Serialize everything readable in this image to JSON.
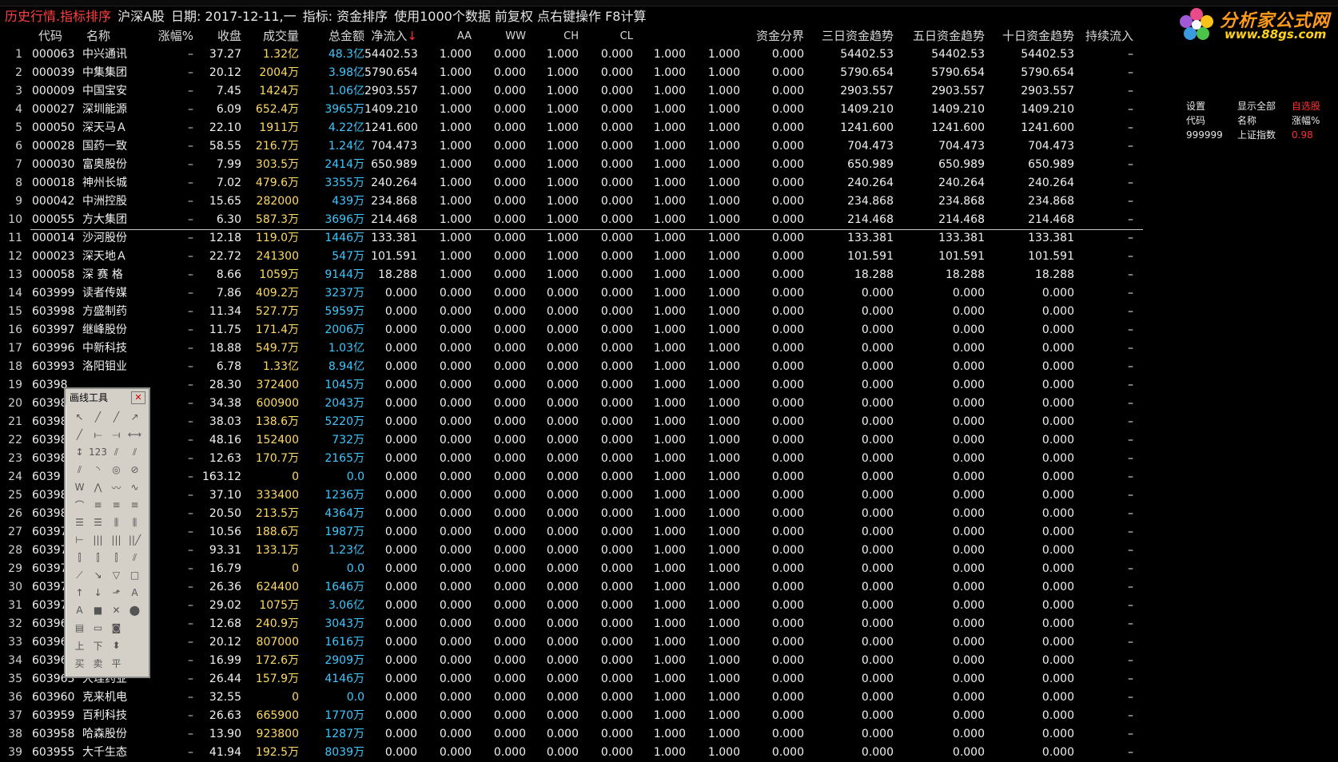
{
  "title_bar": {
    "mode": "历史行情.指标排序",
    "market": "沪深A股",
    "date": "日期: 2017-12-11,一",
    "indicator": "指标: 资金排序",
    "options": "使用1000个数据 前复权 点右键操作 F8计算"
  },
  "logo": {
    "brand": "分析家公式网",
    "url": "www.88gs.com"
  },
  "columns": {
    "code": "代码",
    "name": "名称",
    "change": "涨幅%",
    "close": "收盘",
    "volume": "成交量",
    "amount": "总金额",
    "net_inflow": "净流入",
    "sort_arrow": "↓",
    "aa": "AA",
    "ww": "WW",
    "ch": "CH",
    "cl": "CL",
    "fund_boundary": "资金分界",
    "trend3": "三日资金趋势",
    "trend5": "五日资金趋势",
    "trend10": "十日资金趋势",
    "continuous_inflow": "持续流入"
  },
  "rows": [
    {
      "i": "1",
      "code": "000063",
      "name": "中兴通讯",
      "chg": "–",
      "close": "37.27",
      "vol": "1.32亿",
      "amt": "48.3亿",
      "net": "54402.53",
      "aa": "1.000",
      "ww": "0.000",
      "ch": "1.000",
      "cl": "0.000",
      "x1": "1.000",
      "x2": "1.000",
      "fund": "0.000",
      "t3": "54402.53",
      "t5": "54402.53",
      "t10": "54402.53",
      "cont": "–"
    },
    {
      "i": "2",
      "code": "000039",
      "name": "中集集团",
      "chg": "–",
      "close": "20.12",
      "vol": "2004万",
      "amt": "3.98亿",
      "net": "5790.654",
      "aa": "1.000",
      "ww": "0.000",
      "ch": "1.000",
      "cl": "0.000",
      "x1": "1.000",
      "x2": "1.000",
      "fund": "0.000",
      "t3": "5790.654",
      "t5": "5790.654",
      "t10": "5790.654",
      "cont": "–"
    },
    {
      "i": "3",
      "code": "000009",
      "name": "中国宝安",
      "chg": "–",
      "close": "7.45",
      "vol": "1424万",
      "amt": "1.06亿",
      "net": "2903.557",
      "aa": "1.000",
      "ww": "0.000",
      "ch": "1.000",
      "cl": "0.000",
      "x1": "1.000",
      "x2": "1.000",
      "fund": "0.000",
      "t3": "2903.557",
      "t5": "2903.557",
      "t10": "2903.557",
      "cont": "–"
    },
    {
      "i": "4",
      "code": "000027",
      "name": "深圳能源",
      "chg": "–",
      "close": "6.09",
      "vol": "652.4万",
      "amt": "3965万",
      "net": "1409.210",
      "aa": "1.000",
      "ww": "0.000",
      "ch": "1.000",
      "cl": "0.000",
      "x1": "1.000",
      "x2": "1.000",
      "fund": "0.000",
      "t3": "1409.210",
      "t5": "1409.210",
      "t10": "1409.210",
      "cont": "–"
    },
    {
      "i": "5",
      "code": "000050",
      "name": "深天马Ａ",
      "chg": "–",
      "close": "22.10",
      "vol": "1911万",
      "amt": "4.22亿",
      "net": "1241.600",
      "aa": "1.000",
      "ww": "0.000",
      "ch": "1.000",
      "cl": "0.000",
      "x1": "1.000",
      "x2": "1.000",
      "fund": "0.000",
      "t3": "1241.600",
      "t5": "1241.600",
      "t10": "1241.600",
      "cont": "–"
    },
    {
      "i": "6",
      "code": "000028",
      "name": "国药一致",
      "chg": "–",
      "close": "58.55",
      "vol": "216.7万",
      "amt": "1.24亿",
      "net": "704.473",
      "aa": "1.000",
      "ww": "0.000",
      "ch": "1.000",
      "cl": "0.000",
      "x1": "1.000",
      "x2": "1.000",
      "fund": "0.000",
      "t3": "704.473",
      "t5": "704.473",
      "t10": "704.473",
      "cont": "–"
    },
    {
      "i": "7",
      "code": "000030",
      "name": "富奥股份",
      "chg": "–",
      "close": "7.99",
      "vol": "303.5万",
      "amt": "2414万",
      "net": "650.989",
      "aa": "1.000",
      "ww": "0.000",
      "ch": "1.000",
      "cl": "0.000",
      "x1": "1.000",
      "x2": "1.000",
      "fund": "0.000",
      "t3": "650.989",
      "t5": "650.989",
      "t10": "650.989",
      "cont": "–"
    },
    {
      "i": "8",
      "code": "000018",
      "name": "神州长城",
      "chg": "–",
      "close": "7.02",
      "vol": "479.6万",
      "amt": "3355万",
      "net": "240.264",
      "aa": "1.000",
      "ww": "0.000",
      "ch": "1.000",
      "cl": "0.000",
      "x1": "1.000",
      "x2": "1.000",
      "fund": "0.000",
      "t3": "240.264",
      "t5": "240.264",
      "t10": "240.264",
      "cont": "–"
    },
    {
      "i": "9",
      "code": "000042",
      "name": "中洲控股",
      "chg": "–",
      "close": "15.65",
      "vol": "282000",
      "amt": "439万",
      "net": "234.868",
      "aa": "1.000",
      "ww": "0.000",
      "ch": "1.000",
      "cl": "0.000",
      "x1": "1.000",
      "x2": "1.000",
      "fund": "0.000",
      "t3": "234.868",
      "t5": "234.868",
      "t10": "234.868",
      "cont": "–"
    },
    {
      "i": "10",
      "code": "000055",
      "name": "方大集团",
      "chg": "–",
      "close": "6.30",
      "vol": "587.3万",
      "amt": "3696万",
      "net": "214.468",
      "aa": "1.000",
      "ww": "0.000",
      "ch": "1.000",
      "cl": "0.000",
      "x1": "1.000",
      "x2": "1.000",
      "fund": "0.000",
      "t3": "214.468",
      "t5": "214.468",
      "t10": "214.468",
      "cont": "–"
    },
    {
      "i": "11",
      "code": "000014",
      "name": "沙河股份",
      "chg": "–",
      "close": "12.18",
      "vol": "119.0万",
      "amt": "1446万",
      "net": "133.381",
      "aa": "1.000",
      "ww": "0.000",
      "ch": "1.000",
      "cl": "0.000",
      "x1": "1.000",
      "x2": "1.000",
      "fund": "0.000",
      "t3": "133.381",
      "t5": "133.381",
      "t10": "133.381",
      "cont": "–"
    },
    {
      "i": "12",
      "code": "000023",
      "name": "深天地Ａ",
      "chg": "–",
      "close": "22.72",
      "vol": "241300",
      "amt": "547万",
      "net": "101.591",
      "aa": "1.000",
      "ww": "0.000",
      "ch": "1.000",
      "cl": "0.000",
      "x1": "1.000",
      "x2": "1.000",
      "fund": "0.000",
      "t3": "101.591",
      "t5": "101.591",
      "t10": "101.591",
      "cont": "–"
    },
    {
      "i": "13",
      "code": "000058",
      "name": "深 赛 格",
      "chg": "–",
      "close": "8.66",
      "vol": "1059万",
      "amt": "9144万",
      "net": "18.288",
      "aa": "1.000",
      "ww": "0.000",
      "ch": "1.000",
      "cl": "0.000",
      "x1": "1.000",
      "x2": "1.000",
      "fund": "0.000",
      "t3": "18.288",
      "t5": "18.288",
      "t10": "18.288",
      "cont": "–"
    },
    {
      "i": "14",
      "code": "603999",
      "name": "读者传媒",
      "chg": "–",
      "close": "7.86",
      "vol": "409.2万",
      "amt": "3237万",
      "net": "0.000",
      "aa": "0.000",
      "ww": "0.000",
      "ch": "0.000",
      "cl": "0.000",
      "x1": "1.000",
      "x2": "1.000",
      "fund": "0.000",
      "t3": "0.000",
      "t5": "0.000",
      "t10": "0.000",
      "cont": "–"
    },
    {
      "i": "15",
      "code": "603998",
      "name": "方盛制药",
      "chg": "–",
      "close": "11.34",
      "vol": "527.7万",
      "amt": "5959万",
      "net": "0.000",
      "aa": "0.000",
      "ww": "0.000",
      "ch": "0.000",
      "cl": "0.000",
      "x1": "1.000",
      "x2": "1.000",
      "fund": "0.000",
      "t3": "0.000",
      "t5": "0.000",
      "t10": "0.000",
      "cont": "–"
    },
    {
      "i": "16",
      "code": "603997",
      "name": "继峰股份",
      "chg": "–",
      "close": "11.75",
      "vol": "171.4万",
      "amt": "2006万",
      "net": "0.000",
      "aa": "0.000",
      "ww": "0.000",
      "ch": "0.000",
      "cl": "0.000",
      "x1": "1.000",
      "x2": "1.000",
      "fund": "0.000",
      "t3": "0.000",
      "t5": "0.000",
      "t10": "0.000",
      "cont": "–"
    },
    {
      "i": "17",
      "code": "603996",
      "name": "中新科技",
      "chg": "–",
      "close": "18.88",
      "vol": "549.7万",
      "amt": "1.03亿",
      "net": "0.000",
      "aa": "0.000",
      "ww": "0.000",
      "ch": "0.000",
      "cl": "0.000",
      "x1": "1.000",
      "x2": "1.000",
      "fund": "0.000",
      "t3": "0.000",
      "t5": "0.000",
      "t10": "0.000",
      "cont": "–"
    },
    {
      "i": "18",
      "code": "603993",
      "name": "洛阳钼业",
      "chg": "–",
      "close": "6.78",
      "vol": "1.33亿",
      "amt": "8.94亿",
      "net": "0.000",
      "aa": "0.000",
      "ww": "0.000",
      "ch": "0.000",
      "cl": "0.000",
      "x1": "1.000",
      "x2": "1.000",
      "fund": "0.000",
      "t3": "0.000",
      "t5": "0.000",
      "t10": "0.000",
      "cont": "–"
    },
    {
      "i": "19",
      "code": "60398",
      "name": "",
      "chg": "–",
      "close": "28.30",
      "vol": "372400",
      "amt": "1045万",
      "net": "0.000",
      "aa": "0.000",
      "ww": "0.000",
      "ch": "0.000",
      "cl": "0.000",
      "x1": "1.000",
      "x2": "1.000",
      "fund": "0.000",
      "t3": "0.000",
      "t5": "0.000",
      "t10": "0.000",
      "cont": "–"
    },
    {
      "i": "20",
      "code": "60398",
      "name": "",
      "chg": "–",
      "close": "34.38",
      "vol": "600900",
      "amt": "2043万",
      "net": "0.000",
      "aa": "0.000",
      "ww": "0.000",
      "ch": "0.000",
      "cl": "0.000",
      "x1": "1.000",
      "x2": "1.000",
      "fund": "0.000",
      "t3": "0.000",
      "t5": "0.000",
      "t10": "0.000",
      "cont": "–"
    },
    {
      "i": "21",
      "code": "60398",
      "name": "",
      "chg": "–",
      "close": "38.03",
      "vol": "138.6万",
      "amt": "5220万",
      "net": "0.000",
      "aa": "0.000",
      "ww": "0.000",
      "ch": "0.000",
      "cl": "0.000",
      "x1": "1.000",
      "x2": "1.000",
      "fund": "0.000",
      "t3": "0.000",
      "t5": "0.000",
      "t10": "0.000",
      "cont": "–"
    },
    {
      "i": "22",
      "code": "60398",
      "name": "",
      "chg": "–",
      "close": "48.16",
      "vol": "152400",
      "amt": "732万",
      "net": "0.000",
      "aa": "0.000",
      "ww": "0.000",
      "ch": "0.000",
      "cl": "0.000",
      "x1": "1.000",
      "x2": "1.000",
      "fund": "0.000",
      "t3": "0.000",
      "t5": "0.000",
      "t10": "0.000",
      "cont": "–"
    },
    {
      "i": "23",
      "code": "60398",
      "name": "",
      "chg": "–",
      "close": "12.63",
      "vol": "170.7万",
      "amt": "2165万",
      "net": "0.000",
      "aa": "0.000",
      "ww": "0.000",
      "ch": "0.000",
      "cl": "0.000",
      "x1": "1.000",
      "x2": "1.000",
      "fund": "0.000",
      "t3": "0.000",
      "t5": "0.000",
      "t10": "0.000",
      "cont": "–"
    },
    {
      "i": "24",
      "code": "6039",
      "name": "",
      "chg": "–",
      "close": "163.12",
      "vol": "0",
      "amt": "0.0",
      "net": "0.000",
      "aa": "0.000",
      "ww": "0.000",
      "ch": "0.000",
      "cl": "0.000",
      "x1": "1.000",
      "x2": "1.000",
      "fund": "0.000",
      "t3": "0.000",
      "t5": "0.000",
      "t10": "0.000",
      "cont": "–"
    },
    {
      "i": "25",
      "code": "60398",
      "name": "",
      "chg": "–",
      "close": "37.10",
      "vol": "333400",
      "amt": "1236万",
      "net": "0.000",
      "aa": "0.000",
      "ww": "0.000",
      "ch": "0.000",
      "cl": "0.000",
      "x1": "1.000",
      "x2": "1.000",
      "fund": "0.000",
      "t3": "0.000",
      "t5": "0.000",
      "t10": "0.000",
      "cont": "–"
    },
    {
      "i": "26",
      "code": "60398",
      "name": "",
      "chg": "–",
      "close": "20.50",
      "vol": "213.5万",
      "amt": "4364万",
      "net": "0.000",
      "aa": "0.000",
      "ww": "0.000",
      "ch": "0.000",
      "cl": "0.000",
      "x1": "1.000",
      "x2": "1.000",
      "fund": "0.000",
      "t3": "0.000",
      "t5": "0.000",
      "t10": "0.000",
      "cont": "–"
    },
    {
      "i": "27",
      "code": "60397",
      "name": "",
      "chg": "–",
      "close": "10.56",
      "vol": "188.6万",
      "amt": "1987万",
      "net": "0.000",
      "aa": "0.000",
      "ww": "0.000",
      "ch": "0.000",
      "cl": "0.000",
      "x1": "1.000",
      "x2": "1.000",
      "fund": "0.000",
      "t3": "0.000",
      "t5": "0.000",
      "t10": "0.000",
      "cont": "–"
    },
    {
      "i": "28",
      "code": "60397",
      "name": "",
      "chg": "–",
      "close": "93.31",
      "vol": "133.1万",
      "amt": "1.23亿",
      "net": "0.000",
      "aa": "0.000",
      "ww": "0.000",
      "ch": "0.000",
      "cl": "0.000",
      "x1": "1.000",
      "x2": "1.000",
      "fund": "0.000",
      "t3": "0.000",
      "t5": "0.000",
      "t10": "0.000",
      "cont": "–"
    },
    {
      "i": "29",
      "code": "60397",
      "name": "",
      "chg": "–",
      "close": "16.79",
      "vol": "0",
      "amt": "0.0",
      "net": "0.000",
      "aa": "0.000",
      "ww": "0.000",
      "ch": "0.000",
      "cl": "0.000",
      "x1": "1.000",
      "x2": "1.000",
      "fund": "0.000",
      "t3": "0.000",
      "t5": "0.000",
      "t10": "0.000",
      "cont": "–"
    },
    {
      "i": "30",
      "code": "60397",
      "name": "",
      "chg": "–",
      "close": "26.36",
      "vol": "624400",
      "amt": "1646万",
      "net": "0.000",
      "aa": "0.000",
      "ww": "0.000",
      "ch": "0.000",
      "cl": "0.000",
      "x1": "1.000",
      "x2": "1.000",
      "fund": "0.000",
      "t3": "0.000",
      "t5": "0.000",
      "t10": "0.000",
      "cont": "–"
    },
    {
      "i": "31",
      "code": "60397",
      "name": "",
      "chg": "–",
      "close": "29.02",
      "vol": "1075万",
      "amt": "3.06亿",
      "net": "0.000",
      "aa": "0.000",
      "ww": "0.000",
      "ch": "0.000",
      "cl": "0.000",
      "x1": "1.000",
      "x2": "1.000",
      "fund": "0.000",
      "t3": "0.000",
      "t5": "0.000",
      "t10": "0.000",
      "cont": "–"
    },
    {
      "i": "32",
      "code": "60396",
      "name": "",
      "chg": "–",
      "close": "12.68",
      "vol": "240.9万",
      "amt": "3043万",
      "net": "0.000",
      "aa": "0.000",
      "ww": "0.000",
      "ch": "0.000",
      "cl": "0.000",
      "x1": "1.000",
      "x2": "1.000",
      "fund": "0.000",
      "t3": "0.000",
      "t5": "0.000",
      "t10": "0.000",
      "cont": "–"
    },
    {
      "i": "33",
      "code": "60396",
      "name": "",
      "chg": "–",
      "close": "20.12",
      "vol": "807000",
      "amt": "1616万",
      "net": "0.000",
      "aa": "0.000",
      "ww": "0.000",
      "ch": "0.000",
      "cl": "0.000",
      "x1": "1.000",
      "x2": "1.000",
      "fund": "0.000",
      "t3": "0.000",
      "t5": "0.000",
      "t10": "0.000",
      "cont": "–"
    },
    {
      "i": "34",
      "code": "60396",
      "name": "",
      "chg": "–",
      "close": "16.99",
      "vol": "172.6万",
      "amt": "2909万",
      "net": "0.000",
      "aa": "0.000",
      "ww": "0.000",
      "ch": "0.000",
      "cl": "0.000",
      "x1": "1.000",
      "x2": "1.000",
      "fund": "0.000",
      "t3": "0.000",
      "t5": "0.000",
      "t10": "0.000",
      "cont": "–"
    },
    {
      "i": "35",
      "code": "603963",
      "name": "大理药业",
      "chg": "–",
      "close": "26.44",
      "vol": "157.9万",
      "amt": "4146万",
      "net": "0.000",
      "aa": "0.000",
      "ww": "0.000",
      "ch": "0.000",
      "cl": "0.000",
      "x1": "1.000",
      "x2": "1.000",
      "fund": "0.000",
      "t3": "0.000",
      "t5": "0.000",
      "t10": "0.000",
      "cont": "–"
    },
    {
      "i": "36",
      "code": "603960",
      "name": "克来机电",
      "chg": "–",
      "close": "32.55",
      "vol": "0",
      "amt": "0.0",
      "net": "0.000",
      "aa": "0.000",
      "ww": "0.000",
      "ch": "0.000",
      "cl": "0.000",
      "x1": "1.000",
      "x2": "1.000",
      "fund": "0.000",
      "t3": "0.000",
      "t5": "0.000",
      "t10": "0.000",
      "cont": "–"
    },
    {
      "i": "37",
      "code": "603959",
      "name": "百利科技",
      "chg": "–",
      "close": "26.63",
      "vol": "665900",
      "amt": "1770万",
      "net": "0.000",
      "aa": "0.000",
      "ww": "0.000",
      "ch": "0.000",
      "cl": "0.000",
      "x1": "1.000",
      "x2": "1.000",
      "fund": "0.000",
      "t3": "0.000",
      "t5": "0.000",
      "t10": "0.000",
      "cont": "–"
    },
    {
      "i": "38",
      "code": "603958",
      "name": "哈森股份",
      "chg": "–",
      "close": "13.90",
      "vol": "923800",
      "amt": "1287万",
      "net": "0.000",
      "aa": "0.000",
      "ww": "0.000",
      "ch": "0.000",
      "cl": "0.000",
      "x1": "1.000",
      "x2": "1.000",
      "fund": "0.000",
      "t3": "0.000",
      "t5": "0.000",
      "t10": "0.000",
      "cont": "–"
    },
    {
      "i": "39",
      "code": "603955",
      "name": "大千生态",
      "chg": "–",
      "close": "41.94",
      "vol": "192.5万",
      "amt": "8039万",
      "net": "0.000",
      "aa": "0.000",
      "ww": "0.000",
      "ch": "0.000",
      "cl": "0.000",
      "x1": "1.000",
      "x2": "1.000",
      "fund": "0.000",
      "t3": "0.000",
      "t5": "0.000",
      "t10": "0.000",
      "cont": "–"
    }
  ],
  "side_panel": {
    "settings": "设置",
    "show_all": "显示全部",
    "favorites": "自选股",
    "h_code": "代码",
    "h_name": "名称",
    "h_change": "涨幅%",
    "idx_code": "999999",
    "idx_name": "上证指数",
    "idx_change": "0.98"
  },
  "drawing_tool": {
    "title": "画线工具",
    "close_glyph": "✕",
    "buttons": [
      "↖",
      "╱",
      "╱",
      "↗",
      "╱",
      "⟝",
      "⟞",
      "⟷",
      "↕",
      "123",
      "⫽",
      "⫽",
      "⫽",
      "◝",
      "◎",
      "⊘",
      "W",
      "⋀",
      "〰",
      "∿",
      "⌒",
      "≡",
      "≡",
      "≡",
      "☰",
      "☰",
      "⫼",
      "⫼",
      "⊢",
      "|||",
      "|||",
      "||╱",
      "⫿",
      "⫿",
      "⫿",
      "⫽",
      "⟋",
      "↘",
      "▽",
      "□",
      "↑",
      "↓",
      "⬏",
      "A",
      "A",
      "■",
      "✕",
      "⬤",
      "▤",
      "▭",
      "◙",
      "",
      "上",
      "下",
      "⬍",
      "",
      "买",
      "卖",
      "平",
      ""
    ]
  },
  "colors": {
    "background": "#000000",
    "title_red": "#ff4040",
    "volume": "#ffd966",
    "amount": "#3fc7ff",
    "sort_arrow": "#ff3030",
    "favorites": "#ff3030",
    "index_change": "#ff3030",
    "logo_orange": "#ff9b1a",
    "logo_yellow": "#ffd21a"
  }
}
